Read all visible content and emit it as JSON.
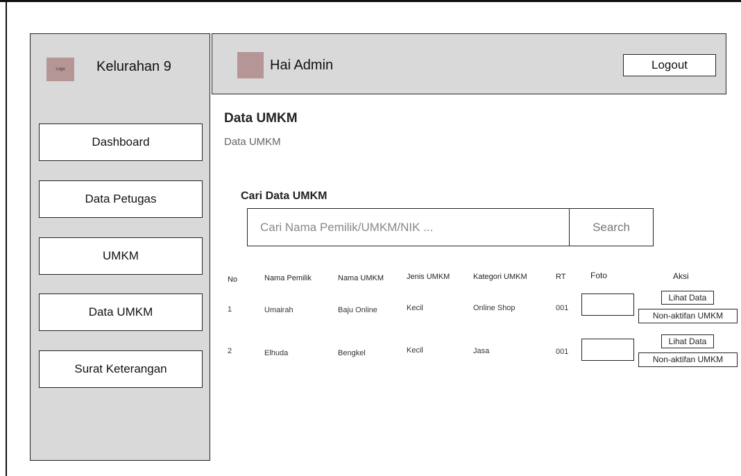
{
  "sidebar": {
    "logo_text": "Logo",
    "brand": "Kelurahan 9",
    "items": [
      {
        "label": "Dashboard"
      },
      {
        "label": "Data Petugas"
      },
      {
        "label": "UMKM"
      },
      {
        "label": "Data UMKM"
      },
      {
        "label": "Surat Keterangan"
      }
    ]
  },
  "header": {
    "greeting": "Hai Admin",
    "logout_label": "Logout"
  },
  "main": {
    "title": "Data UMKM",
    "breadcrumb": "Data UMKM",
    "search": {
      "title": "Cari Data UMKM",
      "placeholder": "Cari Nama Pemilik/UMKM/NIK ...",
      "button_label": "Search"
    },
    "table": {
      "columns": [
        "No",
        "Nama Pemilik",
        "Nama UMKM",
        "Jenis UMKM",
        "Kategori UMKM",
        "RT",
        "Foto",
        "Aksi"
      ],
      "rows": [
        {
          "no": "1",
          "pemilik": "Umairah",
          "umkm": "Baju Online",
          "jenis": "Kecil",
          "kategori": "Online Shop",
          "rt": "001",
          "lihat": "Lihat Data",
          "nonaktif": "Non-aktifan UMKM"
        },
        {
          "no": "2",
          "pemilik": "Elhuda",
          "umkm": "Bengkel",
          "jenis": "Kecil",
          "kategori": "Jasa",
          "rt": "001",
          "lihat": "Lihat Data",
          "nonaktif": "Non-aktifan UMKM"
        }
      ]
    }
  },
  "colors": {
    "panel": "#d9d9d9",
    "placeholder_image": "#b69597"
  }
}
